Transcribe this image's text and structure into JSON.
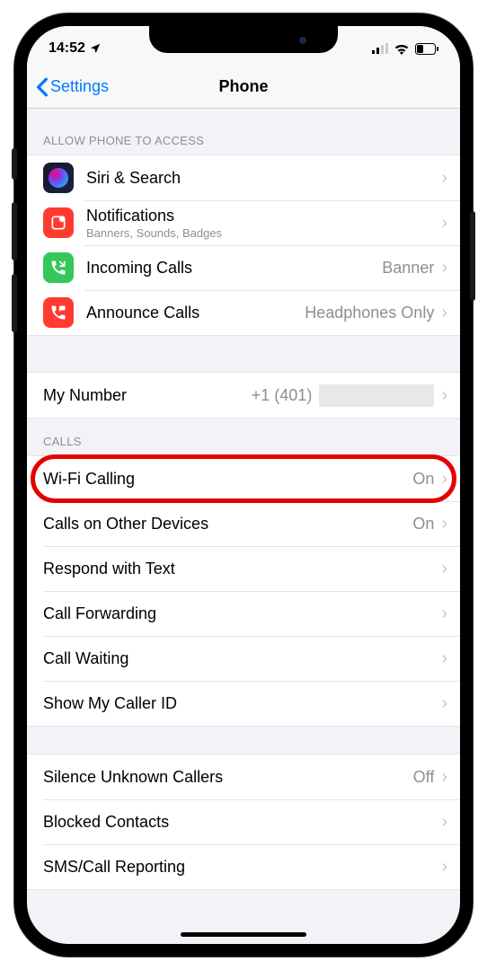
{
  "status": {
    "time": "14:52",
    "location_icon": "location-arrow"
  },
  "nav": {
    "back": "Settings",
    "title": "Phone"
  },
  "sections": {
    "access": {
      "header": "ALLOW PHONE TO ACCESS",
      "rows": [
        {
          "label": "Siri & Search",
          "sub": "",
          "value": ""
        },
        {
          "label": "Notifications",
          "sub": "Banners, Sounds, Badges",
          "value": ""
        },
        {
          "label": "Incoming Calls",
          "sub": "",
          "value": "Banner"
        },
        {
          "label": "Announce Calls",
          "sub": "",
          "value": "Headphones Only"
        }
      ]
    },
    "number": {
      "label": "My Number",
      "value": "+1 (401)"
    },
    "calls": {
      "header": "CALLS",
      "rows": [
        {
          "label": "Wi-Fi Calling",
          "value": "On"
        },
        {
          "label": "Calls on Other Devices",
          "value": "On"
        },
        {
          "label": "Respond with Text",
          "value": ""
        },
        {
          "label": "Call Forwarding",
          "value": ""
        },
        {
          "label": "Call Waiting",
          "value": ""
        },
        {
          "label": "Show My Caller ID",
          "value": ""
        }
      ]
    },
    "more": {
      "rows": [
        {
          "label": "Silence Unknown Callers",
          "value": "Off"
        },
        {
          "label": "Blocked Contacts",
          "value": ""
        },
        {
          "label": "SMS/Call Reporting",
          "value": ""
        }
      ]
    }
  }
}
